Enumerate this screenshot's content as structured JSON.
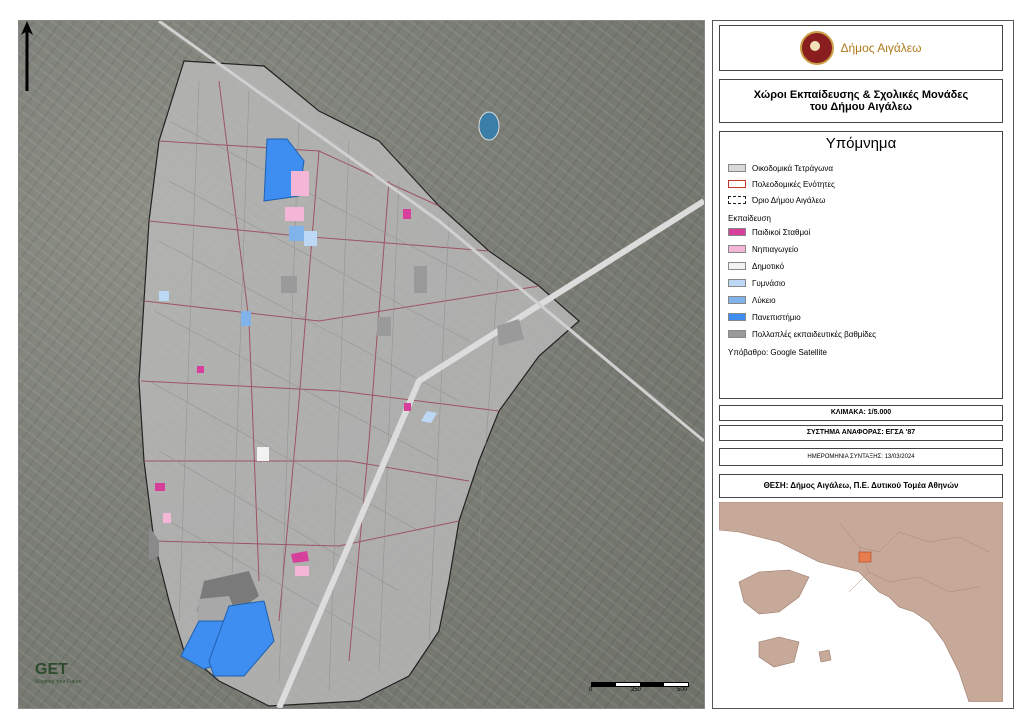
{
  "map": {
    "description_labels": {
      "north_arrow": "north-arrow-icon"
    },
    "scale_bar": {
      "ticks": [
        "0",
        "250",
        "500"
      ]
    },
    "brand": {
      "name": "GET",
      "tagline": "Mapping Your Future"
    }
  },
  "panel": {
    "municipality": "Δήμος Αιγάλεω",
    "title_line1": "Χώροι Εκπαίδευσης & Σχολικές Μονάδες",
    "title_line2": "του Δήμου Αιγάλεω",
    "legend": {
      "heading": "Υπόμνημα",
      "base_items": [
        {
          "label": "Οικοδομικά Τετράγωνα",
          "color": "#d9d9d9",
          "border": "#888888"
        },
        {
          "label": "Πολεοδομικές Ενότητες",
          "color": "#ffffff",
          "border": "#c0392b"
        },
        {
          "label": "Όριο Δήμου Αιγάλεω",
          "color": "#ffffff",
          "border": "#222222"
        }
      ],
      "education_heading": "Εκπαίδευση",
      "education_items": [
        {
          "label": "Παιδικοί Σταθμοί",
          "color": "#d6409a"
        },
        {
          "label": "Νηπιαγωγείο",
          "color": "#f3b6d6"
        },
        {
          "label": "Δημοτικό",
          "color": "#f2f2f2"
        },
        {
          "label": "Γυμνάσιο",
          "color": "#bcd8f4"
        },
        {
          "label": "Λύκειο",
          "color": "#7fb3ea"
        },
        {
          "label": "Πανεπιστήμιο",
          "color": "#3d8ef0"
        },
        {
          "label": "Πολλαπλές εκπαιδευτικές βαθμίδες",
          "color": "#9a9a9a"
        }
      ],
      "basemap_note": "Υπόβαθρο: Google Satellite"
    },
    "scale": "ΚΛΙΜΑΚΑ: 1/5.000",
    "crs": "ΣΥΣΤΗΜΑ ΑΝΑΦΟΡΑΣ: ΕΓΣΑ '87",
    "date": "ΗΜΕΡΟΜΗΝΙΑ ΣΥΝΤΑΞΗΣ: 13/03/2024",
    "location": "ΘΕΣΗ: Δήμος Αιγάλεω, Π.Ε. Δυτικού Τομέα Αθηνών",
    "inset_colors": {
      "land": "#c7a999",
      "sea": "#ffffff",
      "highlight": "#e67e50"
    }
  }
}
